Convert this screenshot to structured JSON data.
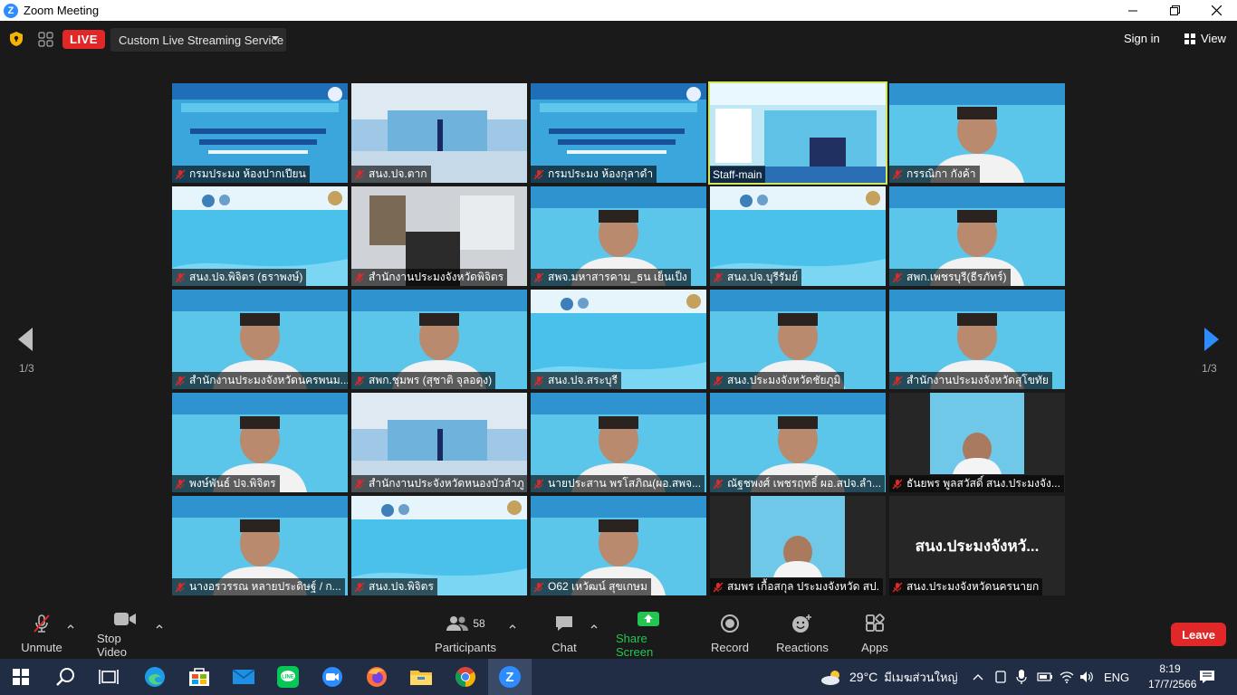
{
  "window": {
    "title": "Zoom Meeting",
    "logo": "Z"
  },
  "topbar": {
    "live_label": "LIVE",
    "stream_label": "Custom Live Streaming Service",
    "signin_label": "Sign in",
    "view_label": "View"
  },
  "navigation": {
    "left_page": "1/3",
    "right_page": "1/3"
  },
  "colors": {
    "live_red": "#e02828",
    "leave_red": "#e02828",
    "share_green": "#23c553",
    "selected_outline": "#cfe85b",
    "tile_blue": "#4cc3e6"
  },
  "participants": [
    {
      "name": "กรมประมง ห้องปากเปียน",
      "muted": true,
      "kind": "slide"
    },
    {
      "name": "สนง.ปจ.ตาก",
      "muted": true,
      "kind": "room"
    },
    {
      "name": "กรมประมง ห้องกุลาดำ",
      "muted": true,
      "kind": "slide"
    },
    {
      "name": "Staff-main",
      "muted": false,
      "kind": "poster",
      "selected": true
    },
    {
      "name": "กรรณิกา กังค้า",
      "muted": true,
      "kind": "person"
    },
    {
      "name": "สนง.ปจ.พิจิตร (ธราพงษ์)",
      "muted": true,
      "kind": "banner"
    },
    {
      "name": "สำนักงานประมงจังหวัดพิจิตร",
      "muted": true,
      "kind": "office"
    },
    {
      "name": "สพจ.มหาสารคาม_ธน เย็นเป็ง",
      "muted": true,
      "kind": "person"
    },
    {
      "name": "สนง.ปจ.บุรีรัมย์",
      "muted": true,
      "kind": "banner"
    },
    {
      "name": "สพก.เพชรบุรี(ธีรภัทร์)",
      "muted": true,
      "kind": "person"
    },
    {
      "name": "สำนักงานประมงจังหวัดนครพนม...",
      "muted": true,
      "kind": "person"
    },
    {
      "name": "สพก.ชุมพร (สุชาติ จุลอดุง)",
      "muted": true,
      "kind": "person"
    },
    {
      "name": "สนง.ปจ.สระบุรี",
      "muted": true,
      "kind": "banner"
    },
    {
      "name": "สนง.ประมงจังหวัดชัยภูมิ",
      "muted": true,
      "kind": "person"
    },
    {
      "name": "สำนักงานประมงจังหวัดสุโขทัย",
      "muted": true,
      "kind": "person"
    },
    {
      "name": "พงษ์พันธ์ ปจ.พิจิตร",
      "muted": true,
      "kind": "person"
    },
    {
      "name": "สำนักงานประจังหวัดหนองบัวลำภู",
      "muted": true,
      "kind": "room"
    },
    {
      "name": "นายประสาน พรโสภิณ(ผอ.สพจ...",
      "muted": true,
      "kind": "person"
    },
    {
      "name": "ณัฐชพงศ์ เพชรฤทธิ์ ผอ.สปจ.ลำ...",
      "muted": true,
      "kind": "person"
    },
    {
      "name": "ธันยพร พูลสวัสดิ์ สนง.ประมงจัง...",
      "muted": true,
      "kind": "person-dark"
    },
    {
      "name": "นางอรวรรณ หลายประดิษฐ์ / ก...",
      "muted": true,
      "kind": "person"
    },
    {
      "name": "สนง.ปจ.พิจิตร",
      "muted": true,
      "kind": "banner"
    },
    {
      "name": "O62 เหวัฒน์ สุขเกษม",
      "muted": true,
      "kind": "person"
    },
    {
      "name": "สมพร เกื้อสกุล ประมงจังหวัด สป.",
      "muted": true,
      "kind": "person-dark"
    },
    {
      "name": "สนง.ประมงจังหวัดนครนายก",
      "muted": true,
      "kind": "nameonly",
      "display": "สนง.ประมงจังหวั..."
    }
  ],
  "toolbar": {
    "unmute": "Unmute",
    "stop_video": "Stop Video",
    "participants": "Participants",
    "participant_count": "58",
    "chat": "Chat",
    "share_screen": "Share Screen",
    "record": "Record",
    "reactions": "Reactions",
    "apps": "Apps",
    "leave": "Leave"
  },
  "taskbar": {
    "weather_temp": "29°C",
    "weather_text": "มีเมฆส่วนใหญ่",
    "lang": "ENG",
    "time": "8:19",
    "date": "17/7/2566",
    "apps": [
      "windows-start",
      "search",
      "task-view",
      "edge",
      "store",
      "mail",
      "line",
      "zoom-client",
      "firefox",
      "file-explorer",
      "chrome",
      "zoom-meeting"
    ]
  }
}
